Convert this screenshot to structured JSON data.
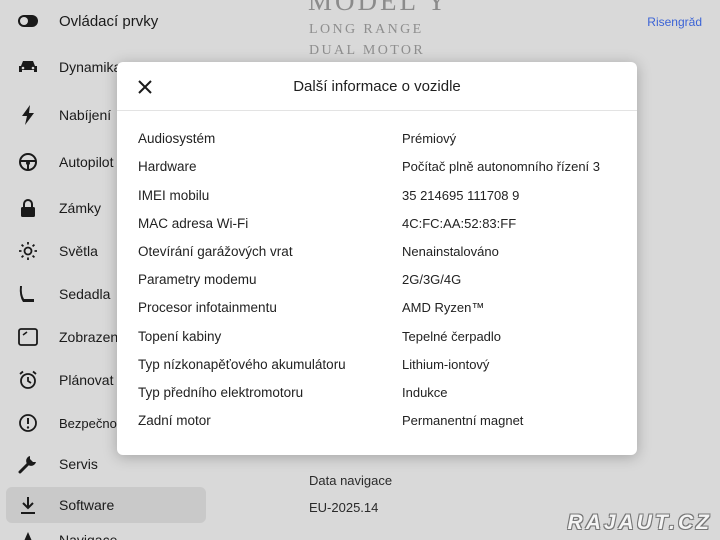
{
  "sidebar": {
    "items": [
      {
        "label": "Ovládací prvky",
        "icon": "toggle-icon"
      },
      {
        "label": "Dynamika",
        "icon": "car-icon"
      },
      {
        "label": "Nabíjení",
        "icon": "lightning-icon"
      },
      {
        "label": "Autopilot",
        "icon": "steering-wheel-icon"
      },
      {
        "label": "Zámky",
        "icon": "lock-icon"
      },
      {
        "label": "Světla",
        "icon": "sun-icon"
      },
      {
        "label": "Sedadla",
        "icon": "seat-icon"
      },
      {
        "label": "Zobrazení",
        "icon": "display-icon"
      },
      {
        "label": "Plánovat",
        "icon": "alarm-clock-icon"
      },
      {
        "label": "Bezpečnost",
        "icon": "alert-circle-icon"
      },
      {
        "label": "Servis",
        "icon": "wrench-icon"
      },
      {
        "label": "Software",
        "icon": "download-icon",
        "active": true
      },
      {
        "label": "Navigace",
        "icon": "navigation-icon"
      }
    ]
  },
  "vehicle": {
    "model": "MODEL Y",
    "variant": "LONG RANGE",
    "drive": "DUAL MOTOR",
    "rename_link": "Risengrǎd"
  },
  "software": {
    "nav_data_label": "Data navigace",
    "nav_data_value": "EU-2025.14"
  },
  "modal": {
    "title": "Další informace o vozidle",
    "rows": [
      {
        "key": "Audiosystém",
        "value": "Prémiový"
      },
      {
        "key": "Hardware",
        "value": "Počítač plně autonomního řízení 3"
      },
      {
        "key": "IMEI mobilu",
        "value": "35 214695 111708 9"
      },
      {
        "key": "MAC adresa Wi-Fi",
        "value": "4C:FC:AA:52:83:FF"
      },
      {
        "key": "Otevírání garážových vrat",
        "value": "Nenainstalováno"
      },
      {
        "key": "Parametry modemu",
        "value": "2G/3G/4G"
      },
      {
        "key": "Procesor infotainmentu",
        "value": "AMD Ryzen™"
      },
      {
        "key": "Topení kabiny",
        "value": "Tepelné čerpadlo"
      },
      {
        "key": "Typ nízkonapěťového akumulátoru",
        "value": "Lithium-iontový"
      },
      {
        "key": "Typ předního elektromotoru",
        "value": "Indukce"
      },
      {
        "key": "Zadní motor",
        "value": "Permanentní magnet"
      }
    ]
  },
  "watermark": "RAJAUT.CZ",
  "colors": {
    "background": "#d9d9d9",
    "modal": "#ffffff",
    "link": "#3b63d6",
    "active_item": "#c9c9c9"
  }
}
